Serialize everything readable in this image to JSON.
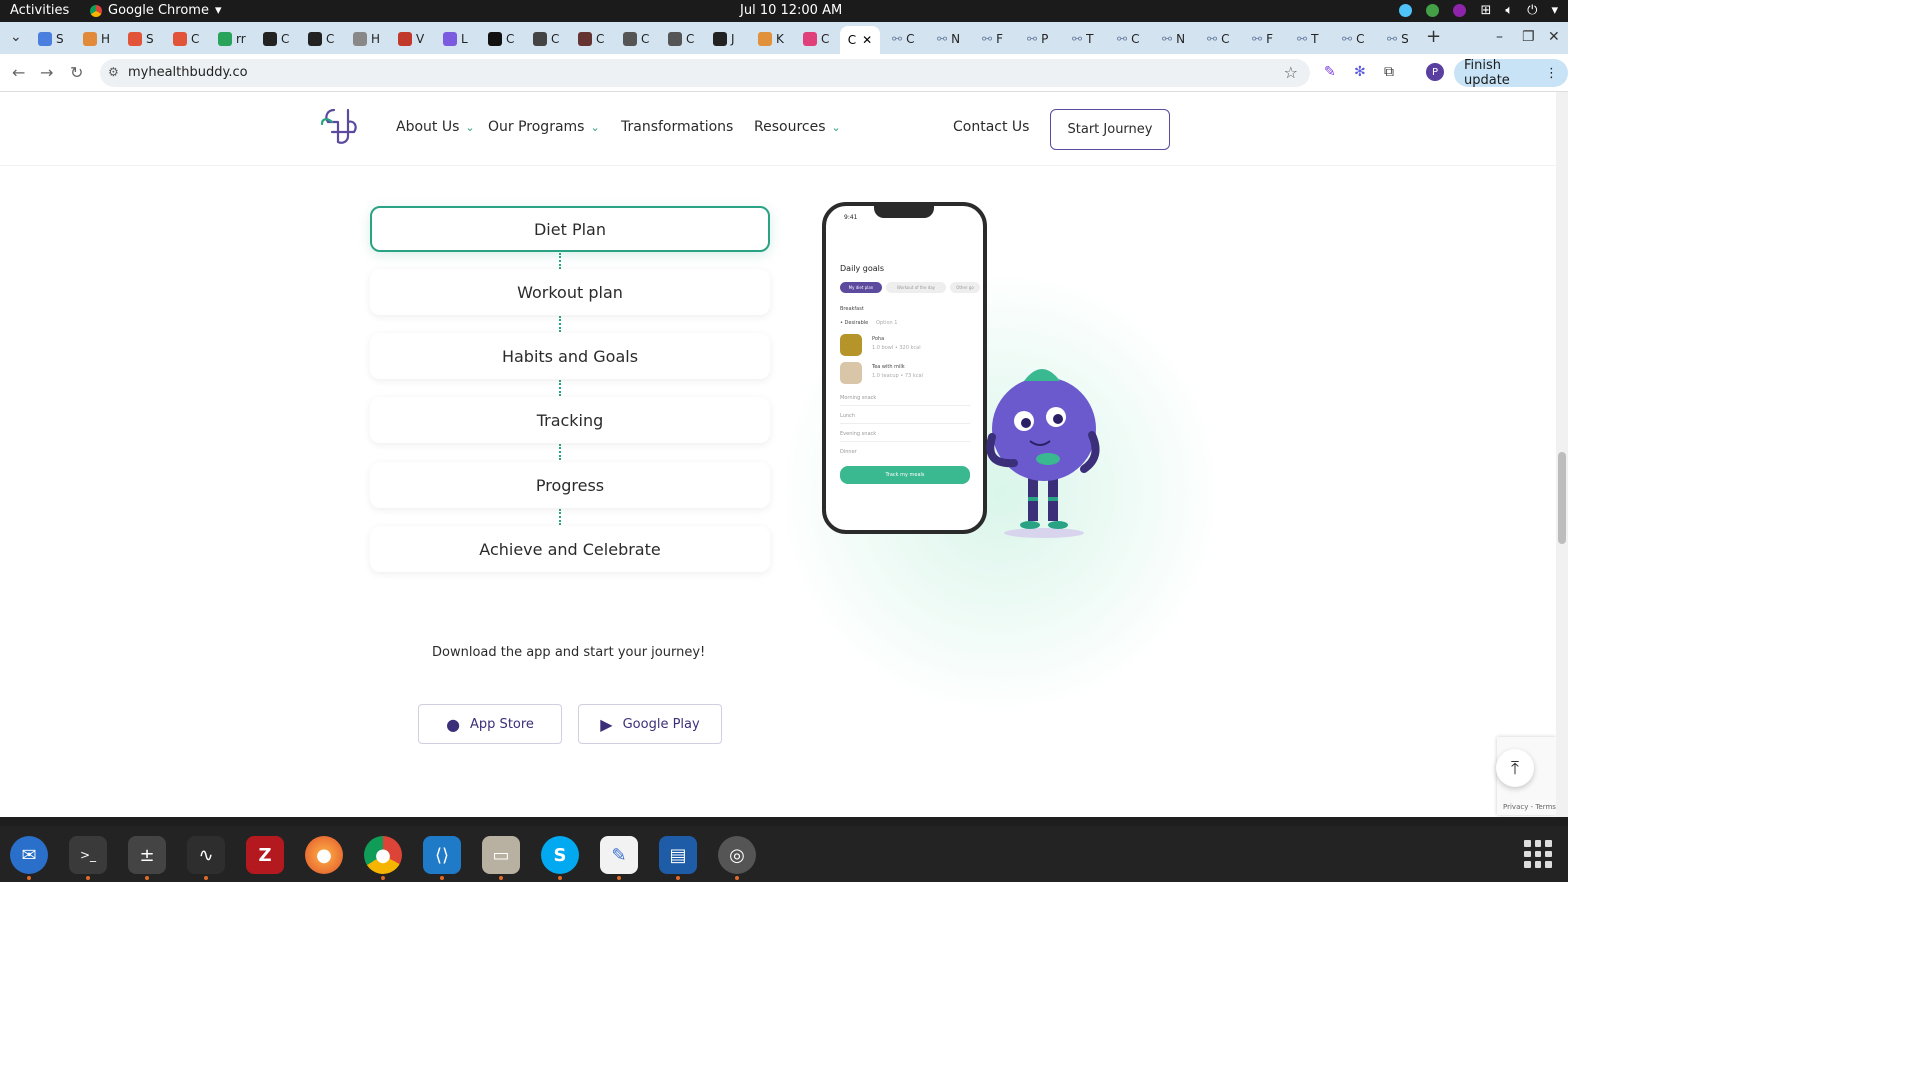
{
  "system_bar": {
    "activities": "Activities",
    "app_name": "Google Chrome",
    "clock": "Jul 10  12:00 AM"
  },
  "tabs": [
    {
      "label": "S",
      "color": "#4a7fe0"
    },
    {
      "label": "H",
      "color": "#e08a3a"
    },
    {
      "label": "S",
      "color": "#e2543a"
    },
    {
      "label": "C",
      "color": "#e2543a"
    },
    {
      "label": "rr",
      "color": "#2aa35a"
    },
    {
      "label": "C",
      "color": "#222222"
    },
    {
      "label": "C",
      "color": "#222222"
    },
    {
      "label": "H",
      "color": "#888888"
    },
    {
      "label": "V",
      "color": "#c0392b"
    },
    {
      "label": "L",
      "color": "#7b5ce0"
    },
    {
      "label": "C",
      "color": "#111111"
    },
    {
      "label": "C",
      "color": "#444444"
    },
    {
      "label": "C",
      "color": "#663333"
    },
    {
      "label": "C",
      "color": "#555555"
    },
    {
      "label": "C",
      "color": "#555555"
    },
    {
      "label": "J",
      "color": "#222222"
    },
    {
      "label": "K",
      "color": "#e0913a"
    },
    {
      "label": "C",
      "color": "#e0407a"
    }
  ],
  "active_tab": {
    "label": "C"
  },
  "tabs_after": [
    "C",
    "N",
    "F",
    "P",
    "T",
    "C",
    "N",
    "C",
    "F",
    "T",
    "C",
    "S"
  ],
  "address_bar": {
    "url": "myhealthbuddy.co",
    "finish_update": "Finish update"
  },
  "site_nav": {
    "about": "About Us",
    "programs": "Our Programs",
    "transformations": "Transformations",
    "resources": "Resources",
    "contact": "Contact Us",
    "start": "Start Journey"
  },
  "steps": [
    "Diet Plan",
    "Workout plan",
    "Habits and Goals",
    "Tracking",
    "Progress",
    "Achieve and Celebrate"
  ],
  "cta": {
    "text": "Download the app and start your journey!",
    "app_store": "App Store",
    "google_play": "Google Play"
  },
  "phone_screen": {
    "time": "9:41",
    "title": "Daily goals",
    "pill_active": "My diet plan",
    "pill_2": "Workout of the day",
    "pill_3": "Other go",
    "breakfast": "Breakfast",
    "desirable": "• Desirable",
    "option": "Option 1",
    "food1": "Poha",
    "food1_sub": "1.0 bowl • 320 kcal",
    "food2": "Tea with milk",
    "food2_sub": "1.0 teacup • 73 kcal",
    "morning_snack": "Morning snack",
    "lunch": "Lunch",
    "evening_snack": "Evening snack",
    "dinner": "Dinner",
    "track": "Track my meals"
  },
  "recaptcha": {
    "text": "Privacy - Terms"
  },
  "profile_initial": "P",
  "colors": {
    "accent_green": "#2aa384",
    "brand_purple": "#5b4a9e"
  }
}
